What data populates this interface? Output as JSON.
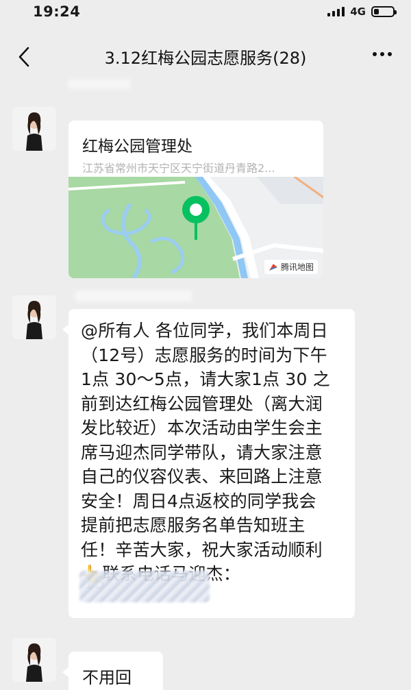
{
  "status_bar": {
    "time": "19:24",
    "network": "4G",
    "battery_level": 0.25
  },
  "nav": {
    "title": "3.12红梅公园志愿服务(28)",
    "back_icon": "chevron-left-icon",
    "more_icon": "more-dots-icon"
  },
  "messages": [
    {
      "type": "location",
      "title": "红梅公园管理处",
      "address": "江苏省常州市天宁区天宁街道丹青路2...",
      "map_attribution": "腾讯地图"
    },
    {
      "type": "text",
      "lines": [
        "@所有人 各位同学，我们本周日",
        "（12号）志愿服务的时间为下午",
        "1点 30～5点，请大家1点 30 之",
        "前到达红梅公园管理处（离大润",
        "发比较近）本次活动由学生会主",
        "席马迎杰同学带队，请大家注意",
        "自己的仪容仪表、来回路上注意",
        "安全！周日4点返校的同学我会",
        "提前把志愿服务名单告知班主",
        "任！辛苦大家，祝大家活动顺利"
      ],
      "contact_emoji": "👆",
      "contact_line": "联系电话马迎杰：",
      "phone_prefix": "13"
    },
    {
      "type": "text",
      "text": "不用回复！"
    }
  ],
  "colors": {
    "background": "#ededed",
    "bubble": "#ffffff",
    "map_pin": "#07c160",
    "map_park": "#a6d6a0",
    "map_water": "#d7ecff"
  }
}
